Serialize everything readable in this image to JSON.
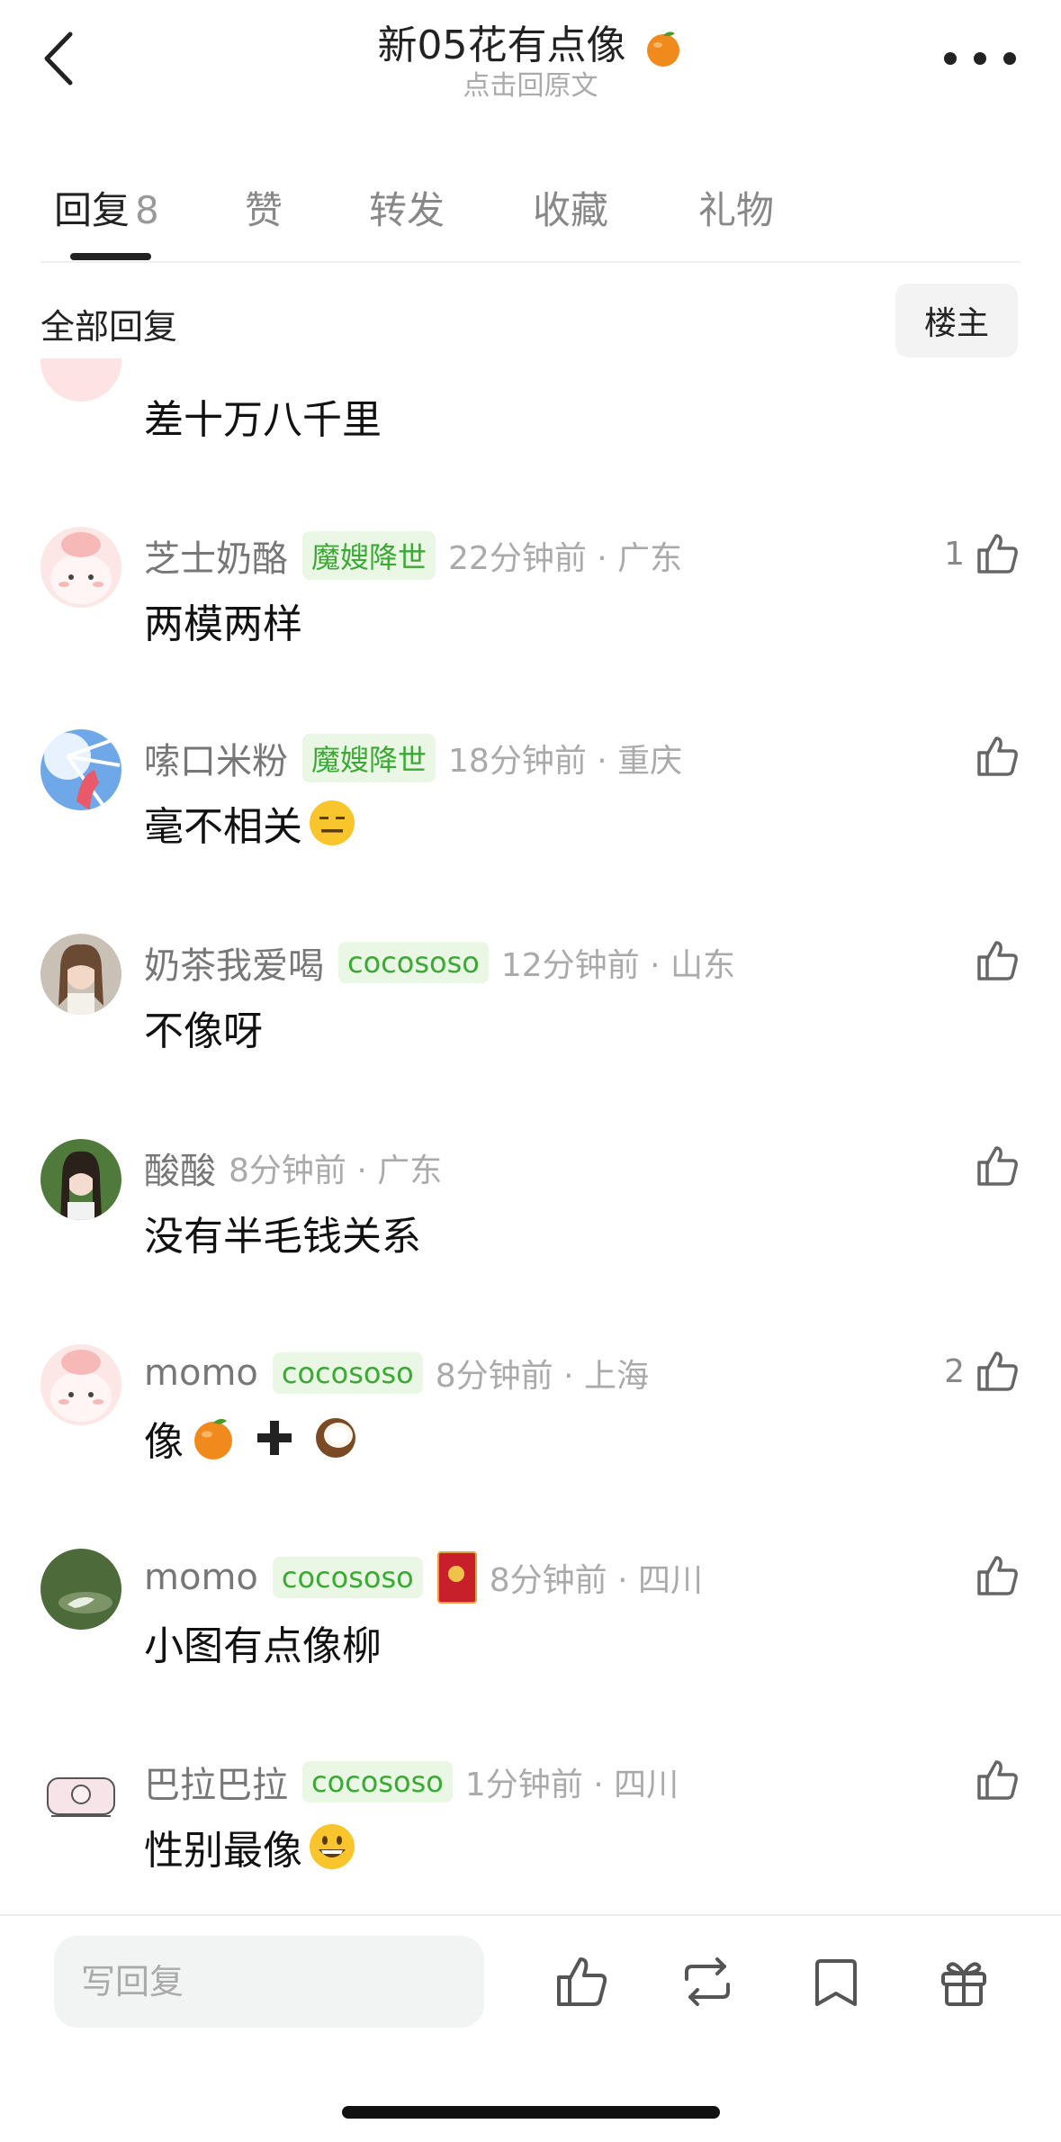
{
  "header": {
    "title": "新05花有点像",
    "subtitle": "点击回原文"
  },
  "tabs": [
    {
      "label": "回复",
      "count": "8"
    },
    {
      "label": "赞"
    },
    {
      "label": "转发"
    },
    {
      "label": "收藏"
    },
    {
      "label": "礼物"
    }
  ],
  "filter": {
    "title": "全部回复",
    "op_label": "楼主"
  },
  "partial_comment": {
    "text": "差十万八千里"
  },
  "comments": [
    {
      "username": "芝士奶酪",
      "badge": "魔嫂降世",
      "time": "22分钟前 · 广东",
      "text": "两模两样",
      "likes": "1"
    },
    {
      "username": "嗦口米粉",
      "badge": "魔嫂降世",
      "time": "18分钟前 · 重庆",
      "text": "毫不相关",
      "likes": ""
    },
    {
      "username": "奶茶我爱喝",
      "badge": "cocososo",
      "time": "12分钟前 · 山东",
      "text": "不像呀",
      "likes": ""
    },
    {
      "username": "酸酸",
      "badge": "",
      "time": "8分钟前 · 广东",
      "text": "没有半毛钱关系",
      "likes": ""
    },
    {
      "username": "momo",
      "badge": "cocososo",
      "time": "8分钟前 · 上海",
      "text": "像",
      "likes": "2"
    },
    {
      "username": "momo",
      "badge": "cocososo",
      "time": "8分钟前 · 四川",
      "text": "小图有点像柳",
      "likes": ""
    },
    {
      "username": "巴拉巴拉",
      "badge": "cocososo",
      "time": "1分钟前 · 四川",
      "text": "性别最像",
      "likes": ""
    }
  ],
  "bottom": {
    "reply_placeholder": "写回复"
  },
  "colors": {
    "badge_green": "#3aaa35",
    "badge_bg": "#eaf7e4"
  }
}
